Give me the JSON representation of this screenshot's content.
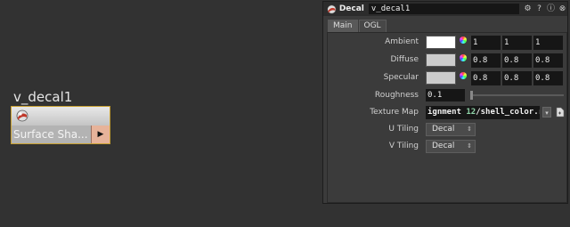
{
  "node": {
    "name": "v_decal1",
    "type_label": "Surface Sha...",
    "output_arrow": "▶",
    "icon": "shader-sphere-icon"
  },
  "panel": {
    "node_type": "Decal",
    "node_name": "v_decal1",
    "header_buttons": [
      "gear-icon",
      "help-icon",
      "info-icon",
      "close-icon"
    ],
    "tabs": [
      {
        "label": "Main",
        "active": true
      },
      {
        "label": "OGL",
        "active": false
      }
    ],
    "params": {
      "ambient": {
        "label": "Ambient",
        "color": "#ffffff",
        "values": [
          "1",
          "1",
          "1"
        ]
      },
      "diffuse": {
        "label": "Diffuse",
        "color": "#cccccc",
        "values": [
          "0.8",
          "0.8",
          "0.8"
        ]
      },
      "specular": {
        "label": "Specular",
        "color": "#cccccc",
        "values": [
          "0.8",
          "0.8",
          "0.8"
        ]
      },
      "roughness": {
        "label": "Roughness",
        "value": "0.1",
        "level": 0.1
      },
      "texture_map": {
        "label": "Texture Map",
        "value_prefix": "ignment ",
        "value_highlight": "12",
        "value_suffix": "/shell_color.rat"
      },
      "u_tiling": {
        "label": "U Tiling",
        "value": "Decal"
      },
      "v_tiling": {
        "label": "V Tiling",
        "value": "Decal"
      }
    }
  },
  "colors": {
    "node_border": "#c8a030",
    "output_connector": "#e7b39a",
    "highlight_text": "#8fd3a8"
  }
}
